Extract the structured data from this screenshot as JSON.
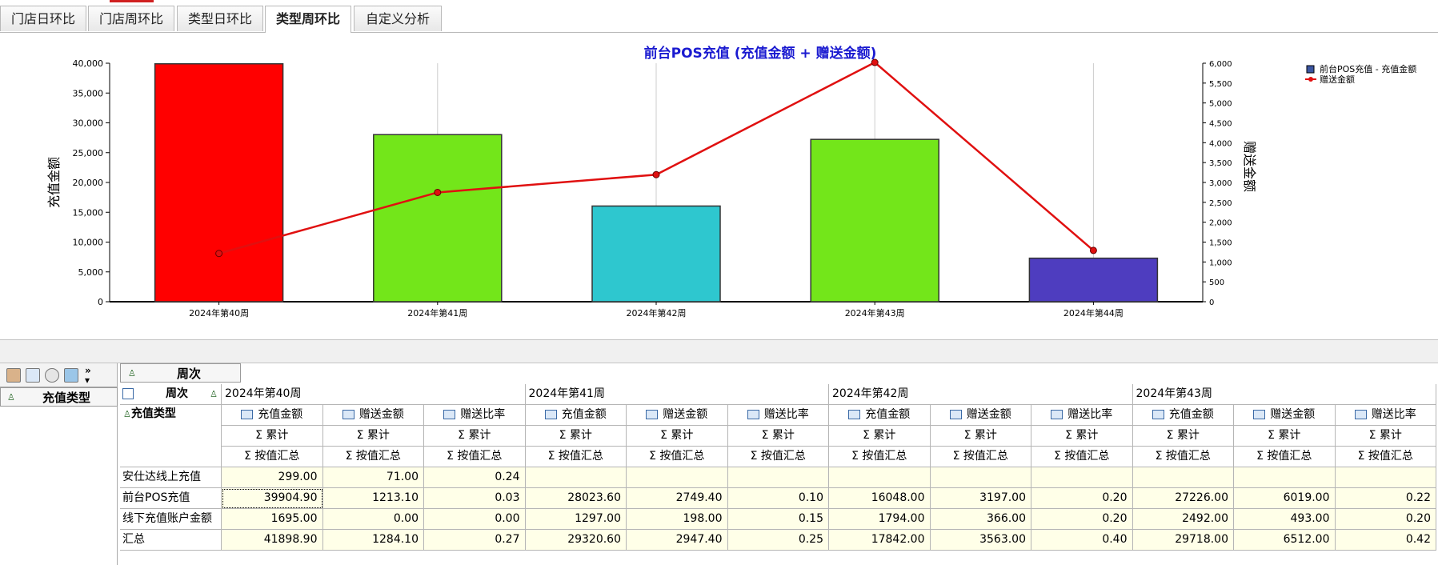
{
  "tabs": [
    {
      "label": "门店日环比",
      "active": false
    },
    {
      "label": "门店周环比",
      "active": false
    },
    {
      "label": "类型日环比",
      "active": false
    },
    {
      "label": "类型周环比",
      "active": true
    },
    {
      "label": "自定义分析",
      "active": false
    }
  ],
  "chart_data": {
    "type": "bar+line",
    "title": "前台POS充值 (充值金额 + 赠送金额)",
    "categories": [
      "2024年第40周",
      "2024年第41周",
      "2024年第42周",
      "2024年第43周",
      "2024年第44周"
    ],
    "ylabel_left": "充值金额",
    "ylabel_right": "赠送金额",
    "ylim_left": [
      0,
      40000
    ],
    "ylim_right": [
      0,
      6000
    ],
    "yticks_left": [
      "0",
      "5,000",
      "10,000",
      "15,000",
      "20,000",
      "25,000",
      "30,000",
      "35,000",
      "40,000"
    ],
    "yticks_right": [
      "0",
      "500",
      "1,000",
      "1,500",
      "2,000",
      "2,500",
      "3,000",
      "3,500",
      "4,000",
      "4,500",
      "5,000",
      "5,500",
      "6,000"
    ],
    "series": [
      {
        "name": "前台POS充值 - 充值金额",
        "kind": "bar",
        "axis": "left",
        "values": [
          39904.9,
          28023.6,
          16048.0,
          27226.0,
          7300
        ],
        "colors": [
          "#ff0000",
          "#73e61a",
          "#2ec7cf",
          "#73e61a",
          "#4e3dbf"
        ]
      },
      {
        "name": "赠送金额",
        "kind": "line",
        "axis": "right",
        "color": "#e01010",
        "values": [
          1213.1,
          2749.4,
          3197.0,
          6019.0,
          1290
        ]
      }
    ],
    "legend_position": "top-right",
    "grid": "vertical"
  },
  "pivot": {
    "column_field": "周次",
    "row_field": "充值类型",
    "weeks": [
      "2024年第40周",
      "2024年第41周",
      "2024年第42周",
      "2024年第43周"
    ],
    "measures": [
      "充值金额",
      "赠送金额",
      "赠送比率"
    ],
    "sum_label": "Σ  累计",
    "agg_label": "Σ  按值汇总",
    "rows": [
      {
        "label": "安仕达线上充值",
        "values": [
          "299.00",
          "71.00",
          "0.24",
          "",
          "",
          "",
          "",
          "",
          "",
          "",
          "",
          ""
        ]
      },
      {
        "label": "前台POS充值",
        "values": [
          "39904.90",
          "1213.10",
          "0.03",
          "28023.60",
          "2749.40",
          "0.10",
          "16048.00",
          "3197.00",
          "0.20",
          "27226.00",
          "6019.00",
          "0.22"
        ]
      },
      {
        "label": "线下充值账户金额",
        "values": [
          "1695.00",
          "0.00",
          "0.00",
          "1297.00",
          "198.00",
          "0.15",
          "1794.00",
          "366.00",
          "0.20",
          "2492.00",
          "493.00",
          "0.20"
        ]
      },
      {
        "label": "汇总",
        "values": [
          "41898.90",
          "1284.10",
          "0.27",
          "29320.60",
          "2947.40",
          "0.25",
          "17842.00",
          "3563.00",
          "0.40",
          "29718.00",
          "6512.00",
          "0.42"
        ]
      }
    ]
  }
}
